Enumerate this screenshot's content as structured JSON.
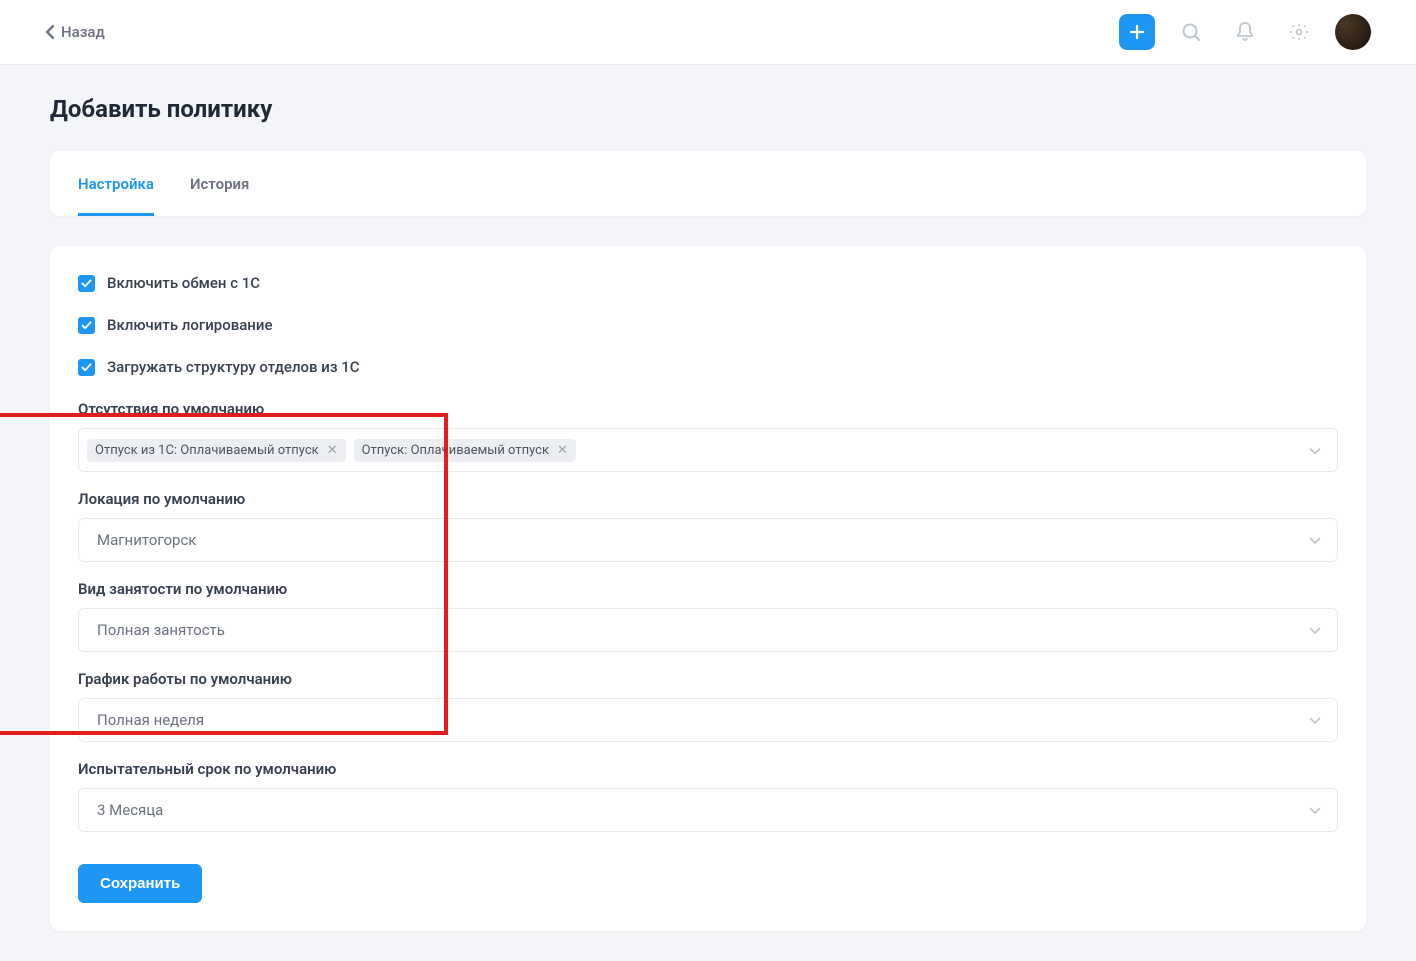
{
  "header": {
    "back_label": "Назад"
  },
  "page": {
    "title": "Добавить политику"
  },
  "tabs": {
    "settings": "Настройка",
    "history": "История"
  },
  "form": {
    "chk1": "Включить обмен с 1С",
    "chk2": "Включить логирование",
    "chk3": "Загружать структуру отделов из 1С",
    "absences_label": "Отсутствия по умолчанию",
    "absences_tags": [
      "Отпуск из 1С: Оплачиваемый отпуск",
      "Отпуск: Оплачиваемый отпуск"
    ],
    "location_label": "Локация по умолчанию",
    "location_value": "Магнитогорск",
    "employment_label": "Вид занятости по умолчанию",
    "employment_value": "Полная занятость",
    "schedule_label": "График работы по умолчанию",
    "schedule_value": "Полная неделя",
    "probation_label": "Испытательный срок по умолчанию",
    "probation_value": "3 Месяца",
    "save_label": "Сохранить"
  }
}
